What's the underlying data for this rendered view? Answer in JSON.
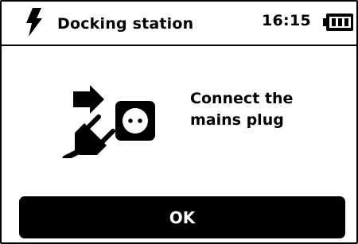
{
  "header": {
    "icon": "lightning-bolt-icon",
    "title": "Docking station",
    "time": "16:15",
    "battery_icon": "battery-full-icon"
  },
  "main": {
    "graphic_icons": [
      "arrow-right-icon",
      "power-plug-icon",
      "wall-socket-icon"
    ],
    "message_line1": "Connect the",
    "message_line2": "mains plug"
  },
  "actions": {
    "ok_label": "OK"
  },
  "colors": {
    "foreground": "#000000",
    "background": "#ffffff"
  }
}
